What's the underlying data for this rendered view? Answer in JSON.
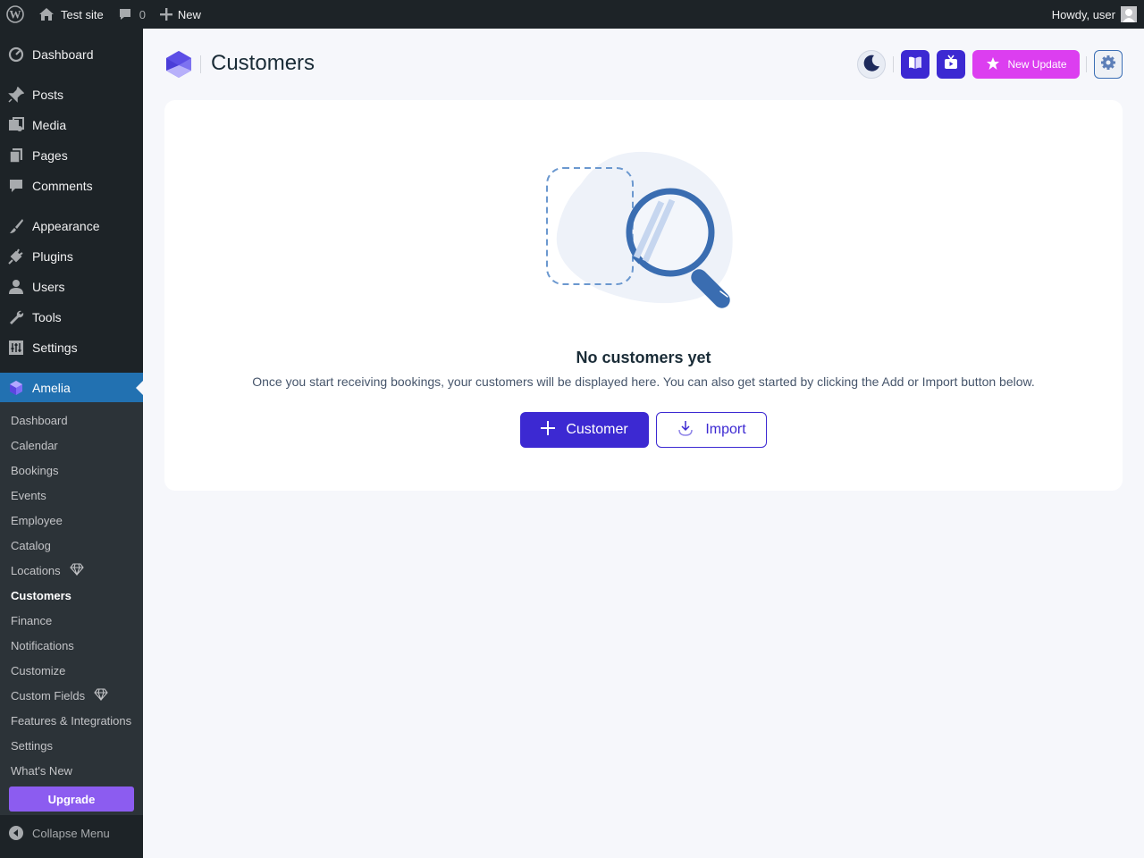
{
  "adminbar": {
    "site_name": "Test site",
    "comments_count": "0",
    "new_label": "New",
    "howdy": "Howdy, user"
  },
  "sidebar": {
    "items": [
      {
        "label": "Dashboard",
        "icon": "dashboard-icon"
      },
      {
        "label": "Posts",
        "icon": "pin-icon"
      },
      {
        "label": "Media",
        "icon": "media-icon"
      },
      {
        "label": "Pages",
        "icon": "pages-icon"
      },
      {
        "label": "Comments",
        "icon": "comment-icon"
      },
      {
        "label": "Appearance",
        "icon": "brush-icon"
      },
      {
        "label": "Plugins",
        "icon": "plug-icon"
      },
      {
        "label": "Users",
        "icon": "user-icon"
      },
      {
        "label": "Tools",
        "icon": "wrench-icon"
      },
      {
        "label": "Settings",
        "icon": "settings-icon"
      },
      {
        "label": "Amelia",
        "icon": "amelia-icon"
      }
    ],
    "submenu": [
      {
        "label": "Dashboard"
      },
      {
        "label": "Calendar"
      },
      {
        "label": "Bookings"
      },
      {
        "label": "Events"
      },
      {
        "label": "Employee"
      },
      {
        "label": "Catalog"
      },
      {
        "label": "Locations",
        "badge": "diamond-icon"
      },
      {
        "label": "Customers",
        "current": true
      },
      {
        "label": "Finance"
      },
      {
        "label": "Notifications"
      },
      {
        "label": "Customize"
      },
      {
        "label": "Custom Fields",
        "badge": "diamond-icon"
      },
      {
        "label": "Features & Integrations"
      },
      {
        "label": "Settings"
      },
      {
        "label": "What's New"
      }
    ],
    "upgrade_label": "Upgrade",
    "collapse_label": "Collapse Menu"
  },
  "header": {
    "title": "Customers",
    "new_update_label": "New Update"
  },
  "empty_state": {
    "title": "No customers yet",
    "description": "Once you start receiving bookings, your customers will be displayed here. You can also get started by clicking the Add or Import button below.",
    "add_button_label": "Customer",
    "import_button_label": "Import"
  },
  "colors": {
    "accent": "#3c29d2",
    "new_update": "#dc3ef0",
    "wp_admin_dark": "#1d2327",
    "wp_active": "#2271b1",
    "upgrade": "#8c5cf0"
  }
}
